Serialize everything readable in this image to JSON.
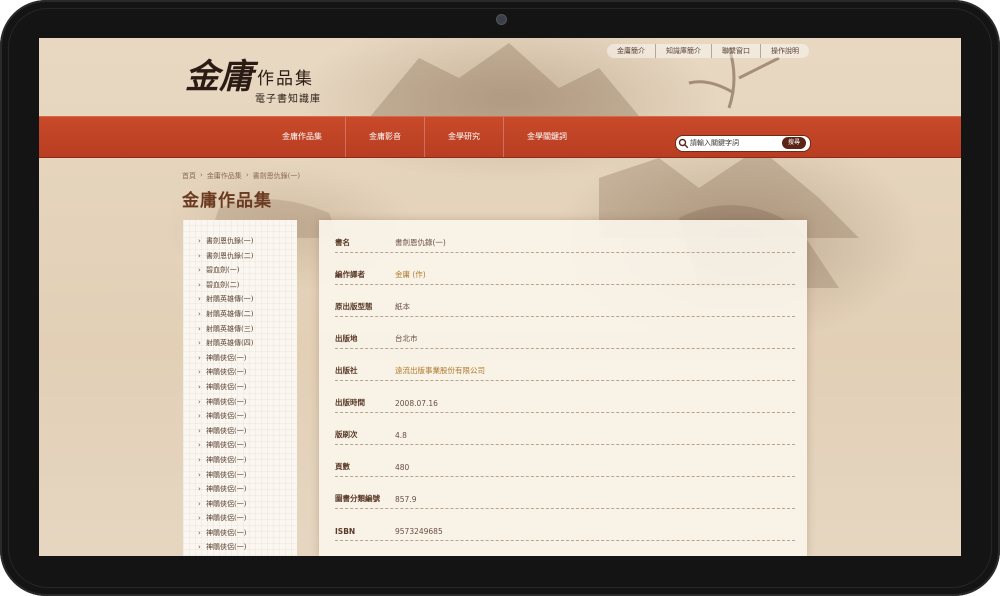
{
  "top_links": [
    "金庸簡介",
    "知識庫簡介",
    "聯繫窗口",
    "操作說明"
  ],
  "logo": {
    "calligraphy": "金庸",
    "title": "作品集",
    "subtitle": "電子書知識庫"
  },
  "nav": {
    "items": [
      "金庸作品集",
      "金庸影音",
      "金學研究",
      "金學關鍵詞"
    ]
  },
  "search": {
    "placeholder": "請輸入關鍵字詞",
    "button_label": "搜尋"
  },
  "breadcrumb": [
    "首頁",
    "金庸作品集",
    "書劍恩仇錄(一)"
  ],
  "page_title": "金庸作品集",
  "sidebar": {
    "items": [
      "書劍恩仇錄(一)",
      "書劍恩仇錄(二)",
      "碧血劍(一)",
      "碧血劍(二)",
      "射鵰英雄傳(一)",
      "射鵰英雄傳(二)",
      "射鵰英雄傳(三)",
      "射鵰英雄傳(四)",
      "神鵰俠侶(一)",
      "神鵰俠侶(一)",
      "神鵰俠侶(一)",
      "神鵰俠侶(一)",
      "神鵰俠侶(一)",
      "神鵰俠侶(一)",
      "神鵰俠侶(一)",
      "神鵰俠侶(一)",
      "神鵰俠侶(一)",
      "神鵰俠侶(一)",
      "神鵰俠侶(一)",
      "神鵰俠侶(一)",
      "神鵰俠侶(一)",
      "神鵰俠侶(一)",
      "神鵰俠侶(一)"
    ]
  },
  "details": [
    {
      "label": "書名",
      "value": "書劍恩仇錄(一)"
    },
    {
      "label": "編作譯者",
      "value": "金庸 (作)"
    },
    {
      "label": "原出版型態",
      "value": "紙本"
    },
    {
      "label": "出版地",
      "value": "台北市"
    },
    {
      "label": "出版社",
      "value": "遠流出版事業股份有限公司"
    },
    {
      "label": "出版時間",
      "value": "2008.07.16"
    },
    {
      "label": "版刷次",
      "value": "4.8"
    },
    {
      "label": "頁數",
      "value": "480"
    },
    {
      "label": "圖書分類編號",
      "value": "857.9"
    },
    {
      "label": "ISBN",
      "value": "9573249685"
    }
  ]
}
